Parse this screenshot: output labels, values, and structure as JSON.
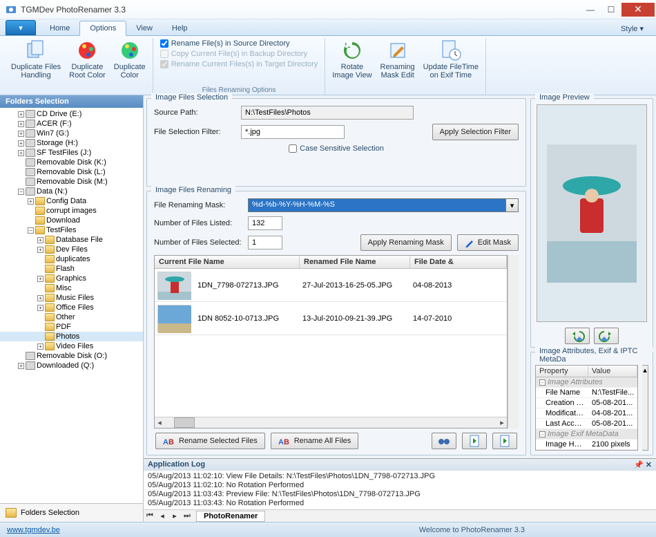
{
  "app": {
    "title": "TGMDev PhotoRenamer 3.3"
  },
  "menu": {
    "tabs": [
      "Home",
      "Options",
      "View",
      "Help"
    ],
    "active": 1,
    "style": "Style"
  },
  "ribbon": {
    "dup_files": "Duplicate Files\nHandling",
    "dup_root": "Duplicate\nRoot Color",
    "dup_color": "Duplicate\nColor",
    "chk1": "Rename File(s) in Source Directory",
    "chk2": "Copy Current File(s) in Backup Directory",
    "chk3": "Rename Current Files(s) in Target Directory",
    "group_chk_label": "Files Renaming Options",
    "rotate": "Rotate\nImage View",
    "mask_edit": "Renaming\nMask Edit",
    "update_ft": "Update FileTime\non Exif Time"
  },
  "tree": {
    "header": "Folders Selection",
    "footer": "Folders Selection",
    "items": [
      {
        "ind": 1,
        "pm": "+",
        "ico": "cd",
        "label": "CD Drive (E:)"
      },
      {
        "ind": 1,
        "pm": "+",
        "ico": "drv",
        "label": "ACER (F:)"
      },
      {
        "ind": 1,
        "pm": "+",
        "ico": "drv",
        "label": "Win7 (G:)"
      },
      {
        "ind": 1,
        "pm": "+",
        "ico": "drv",
        "label": "Storage (H:)"
      },
      {
        "ind": 1,
        "pm": "+",
        "ico": "drv",
        "label": "SF TestFiles (J:)"
      },
      {
        "ind": 1,
        "pm": " ",
        "ico": "drv",
        "label": "Removable Disk (K:)"
      },
      {
        "ind": 1,
        "pm": " ",
        "ico": "drv",
        "label": "Removable Disk (L:)"
      },
      {
        "ind": 1,
        "pm": " ",
        "ico": "drv",
        "label": "Removable Disk (M:)"
      },
      {
        "ind": 1,
        "pm": "−",
        "ico": "drv",
        "label": "Data (N:)"
      },
      {
        "ind": 2,
        "pm": "+",
        "ico": "fld",
        "label": "Config Data"
      },
      {
        "ind": 2,
        "pm": " ",
        "ico": "fld",
        "label": "corrupt images"
      },
      {
        "ind": 2,
        "pm": " ",
        "ico": "fld",
        "label": "Download"
      },
      {
        "ind": 2,
        "pm": "−",
        "ico": "fld",
        "label": "TestFiles"
      },
      {
        "ind": 3,
        "pm": "+",
        "ico": "fld",
        "label": "Database File"
      },
      {
        "ind": 3,
        "pm": "+",
        "ico": "fld",
        "label": "Dev Files"
      },
      {
        "ind": 3,
        "pm": " ",
        "ico": "fld",
        "label": "duplicates"
      },
      {
        "ind": 3,
        "pm": " ",
        "ico": "fld",
        "label": "Flash"
      },
      {
        "ind": 3,
        "pm": "+",
        "ico": "fld",
        "label": "Graphics"
      },
      {
        "ind": 3,
        "pm": " ",
        "ico": "fld",
        "label": "Misc"
      },
      {
        "ind": 3,
        "pm": "+",
        "ico": "fld",
        "label": "Music Files"
      },
      {
        "ind": 3,
        "pm": "+",
        "ico": "fld",
        "label": "Office Files"
      },
      {
        "ind": 3,
        "pm": " ",
        "ico": "fld",
        "label": "Other"
      },
      {
        "ind": 3,
        "pm": " ",
        "ico": "fld",
        "label": "PDF"
      },
      {
        "ind": 3,
        "pm": " ",
        "ico": "fld",
        "label": "Photos",
        "sel": true
      },
      {
        "ind": 3,
        "pm": "+",
        "ico": "fld",
        "label": "Video Files"
      },
      {
        "ind": 1,
        "pm": " ",
        "ico": "drv",
        "label": "Removable Disk (O:)"
      },
      {
        "ind": 1,
        "pm": "+",
        "ico": "drv",
        "label": "Downloaded (Q:)"
      }
    ]
  },
  "selection": {
    "title": "Image Files Selection",
    "source_lbl": "Source Path:",
    "source_val": "N:\\TestFiles\\Photos",
    "filter_lbl": "File Selection Filter:",
    "filter_val": "*.jpg",
    "apply_btn": "Apply Selection Filter",
    "case_chk": "Case Sensitive Selection"
  },
  "renaming": {
    "title": "Image Files Renaming",
    "mask_lbl": "File Renaming Mask:",
    "mask_val": "%d-%b-%Y-%H-%M-%S",
    "listed_lbl": "Number of Files Listed:",
    "listed_val": "132",
    "selected_lbl": "Number of Files Selected:",
    "selected_val": "1",
    "apply_btn": "Apply Renaming Mask",
    "edit_btn": "Edit Mask",
    "cols": [
      "Current File Name",
      "Renamed File Name",
      "File Date &"
    ],
    "rows": [
      {
        "cur": "1DN_7798-072713.JPG",
        "ren": "27-Jul-2013-16-25-05.JPG",
        "date": "04-08-2013"
      },
      {
        "cur": "1DN  8052-10-0713.JPG",
        "ren": "13-Jul-2010-09-21-39.JPG",
        "date": "14-07-2010"
      }
    ],
    "rename_sel": "Rename Selected Files",
    "rename_all": "Rename All Files"
  },
  "preview": {
    "title": "Image Preview"
  },
  "attrs": {
    "title": "Image Attributes, Exif & IPTC MetaDa",
    "cols": [
      "Property",
      "Value"
    ],
    "s1": "Image Attributes",
    "rows1": [
      {
        "p": "File Name",
        "v": "N:\\TestFile..."
      },
      {
        "p": "Creation Ti...",
        "v": "05-08-201..."
      },
      {
        "p": "Modificatio...",
        "v": "04-08-201..."
      },
      {
        "p": "Last Acces...",
        "v": "05-08-201..."
      }
    ],
    "s2": "Image Exif MetaData",
    "rows2": [
      {
        "p": "Image Height",
        "v": "2100 pixels"
      }
    ]
  },
  "log": {
    "title": "Application Log",
    "lines": [
      "05/Aug/2013 11:02:10: View File Details: N:\\TestFiles\\Photos\\1DN_7798-072713.JPG",
      "05/Aug/2013 11:02:10: No Rotation Performed",
      "05/Aug/2013 11:03:43: Preview File: N:\\TestFiles\\Photos\\1DN_7798-072713.JPG",
      "05/Aug/2013 11:03:43: No Rotation Performed"
    ],
    "tab": "PhotoRenamer"
  },
  "status": {
    "link": "www.tgmdev.be",
    "welcome": "Welcome to PhotoRenamer 3.3"
  }
}
